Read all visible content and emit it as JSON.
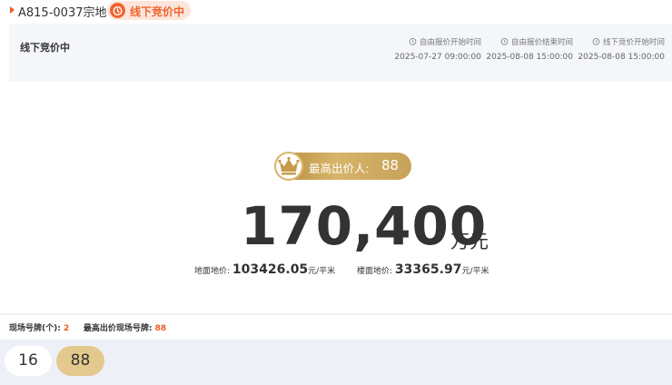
{
  "header": {
    "parcel": "A815-0037宗地",
    "status": "线下竞价中",
    "icons": {
      "marker": "triangle-right-icon",
      "status": "alarm-clock-icon"
    },
    "accent_color": "#f05a23"
  },
  "info": {
    "phase": "线下竞价中",
    "times": [
      {
        "label": "自由报价开始时间",
        "value": "2025-07-27 09:00:00",
        "icon": "clock-icon"
      },
      {
        "label": "自由报价结束时间",
        "value": "2025-08-08 15:00:00",
        "icon": "clock-icon"
      },
      {
        "label": "线下竞价开始时间",
        "value": "2025-08-08 15:00:00",
        "icon": "clock-icon"
      }
    ]
  },
  "bid": {
    "top_bidder_label": "最高出价人:",
    "top_bidder": "88",
    "price": "170,400",
    "price_unit": "万元",
    "land_price_label": "地面地价:",
    "land_price": "103426.05",
    "land_price_unit": "元/平米",
    "floor_price_label": "楼面地价:",
    "floor_price": "33365.97",
    "floor_price_unit": "元/平米",
    "gold_color": "#c9a45a"
  },
  "plates": {
    "count_label": "现场号牌(个):",
    "count": "2",
    "top_label": "最高出价现场号牌:",
    "top": "88",
    "items": [
      "16",
      "88"
    ]
  }
}
